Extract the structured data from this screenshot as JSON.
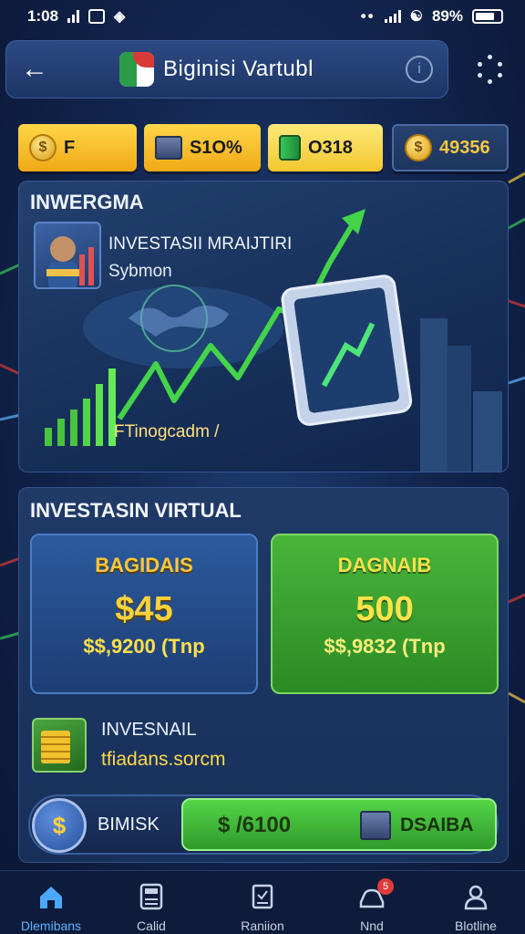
{
  "status_bar": {
    "time": "1:08",
    "battery": "89%"
  },
  "header": {
    "title": "Biginisi Vartubl",
    "back_icon": "arrow-left-icon",
    "info_icon": "info-icon",
    "menu_icon": "dots-grid-icon"
  },
  "chips": [
    {
      "icon": "coin-stack-icon",
      "value": "F"
    },
    {
      "icon": "stack-box-icon",
      "value": "S1O%"
    },
    {
      "icon": "green-bill-icon",
      "value": "O318"
    },
    {
      "icon": "coin-icon",
      "value": "49356"
    }
  ],
  "hero": {
    "title": "INWERGMA",
    "subtitle_1": "INVESTASII MRAIJTIRI",
    "subtitle_2": "Sybmon",
    "caption": "FTinogcadm /"
  },
  "investasi": {
    "title": "INVESTASIN VIRTUAL",
    "card_left": {
      "label": "BAGIDAIS",
      "value": "$45",
      "sub": "$$,9200 (Tnp"
    },
    "card_right": {
      "label": "DAGNAIB",
      "value": "500",
      "sub": "$$,9832 (Tnp"
    },
    "row": {
      "title": "INVESNAIL",
      "link": "tfiadans.sorcm"
    },
    "action": {
      "left_label": "BIMISK",
      "amount": "$ /6100",
      "right_label": "DSAIBA"
    }
  },
  "bottom_nav": [
    {
      "label": "Dlemibans",
      "icon": "home-icon",
      "active": true
    },
    {
      "label": "Calid",
      "icon": "calculator-icon",
      "active": false
    },
    {
      "label": "Raniion",
      "icon": "document-icon",
      "active": false
    },
    {
      "label": "Nnd",
      "icon": "car-icon",
      "active": false,
      "badge": "5"
    },
    {
      "label": "Blotline",
      "icon": "user-icon",
      "active": false
    }
  ],
  "colors": {
    "accent_gold": "#f0a915",
    "accent_green": "#2f9a2a",
    "nav_active": "#5fb3ff"
  }
}
